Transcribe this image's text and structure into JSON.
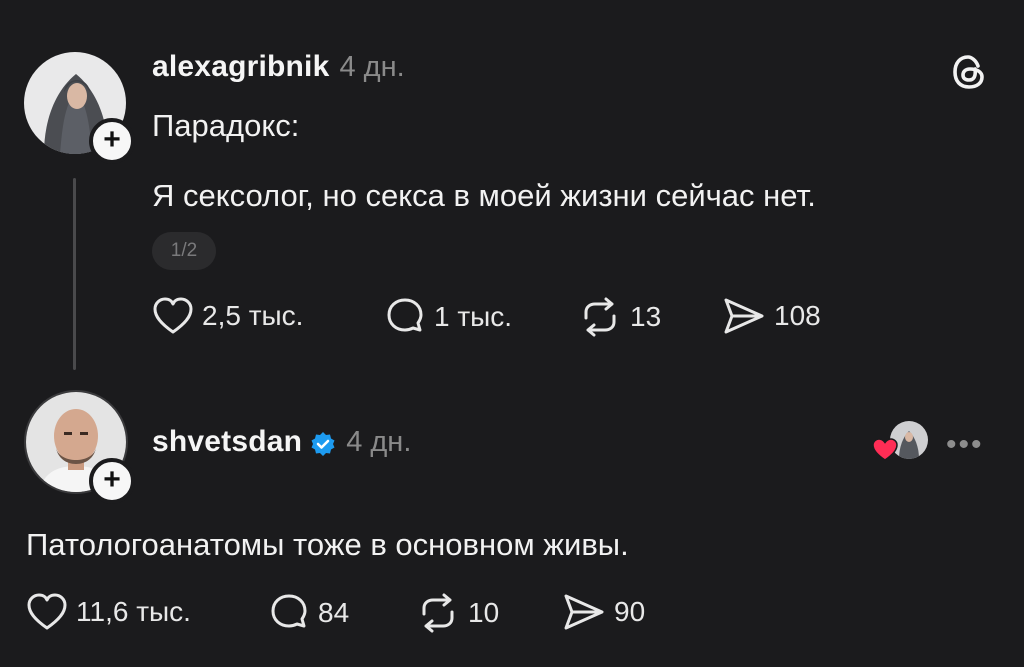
{
  "post1": {
    "username": "alexagribnik",
    "time": "4 дн.",
    "line1": "Парадокс:",
    "line2": "Я сексолог, но секса в моей жизни сейчас нет.",
    "pager": "1/2",
    "likes": "2,5 тыс.",
    "comments": "1 тыс.",
    "reposts": "13",
    "shares": "108"
  },
  "post2": {
    "username": "shvetsdan",
    "time": "4 дн.",
    "text": "Патологоанатомы тоже в основном живы.",
    "likes": "11,6 тыс.",
    "comments": "84",
    "reposts": "10",
    "shares": "90",
    "more": "•••"
  },
  "icons": {
    "app_logo": "threads-logo-icon",
    "like": "heart-icon",
    "comment": "comment-bubble-icon",
    "repost": "repost-icon",
    "share": "send-icon",
    "verified": "verified-badge-icon"
  },
  "colors": {
    "background": "#1b1b1d",
    "verified": "#1d9bf0",
    "liked_heart": "#ff2d55"
  }
}
